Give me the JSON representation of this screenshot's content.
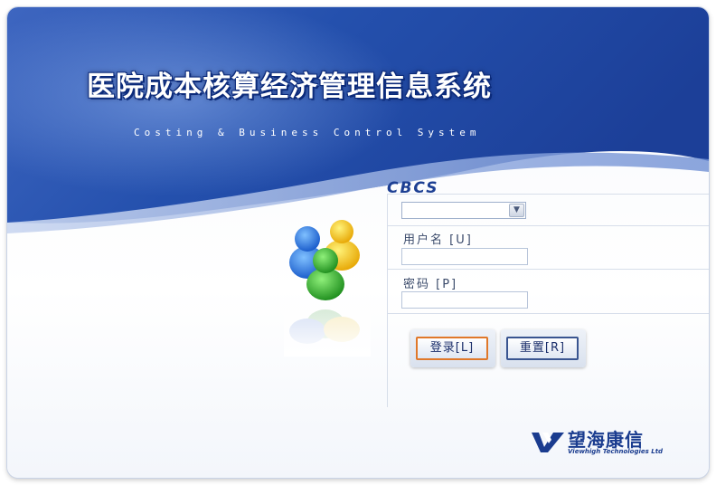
{
  "header": {
    "title": "医院成本核算经济管理信息系统",
    "subtitle": "Costing & Business Control System"
  },
  "login": {
    "brand_abbr": "CBCS",
    "unit_select_value": "",
    "username_label": "用户名 [U]",
    "username_value": "",
    "password_label": "密码 [P]",
    "password_value": "",
    "login_button": "登录[L]",
    "reset_button": "重置[R]"
  },
  "footer": {
    "company_name_cn": "望海康信",
    "company_name_en": "Viewhigh Technologies Ltd"
  },
  "colors": {
    "banner_blue": "#1f4aa8",
    "accent_orange": "#e0782a",
    "text_blue": "#1a3c8f"
  },
  "icons": {
    "users": "users-group-icon",
    "dropdown": "chevron-down-icon",
    "logo": "viewhigh-logo-icon"
  }
}
